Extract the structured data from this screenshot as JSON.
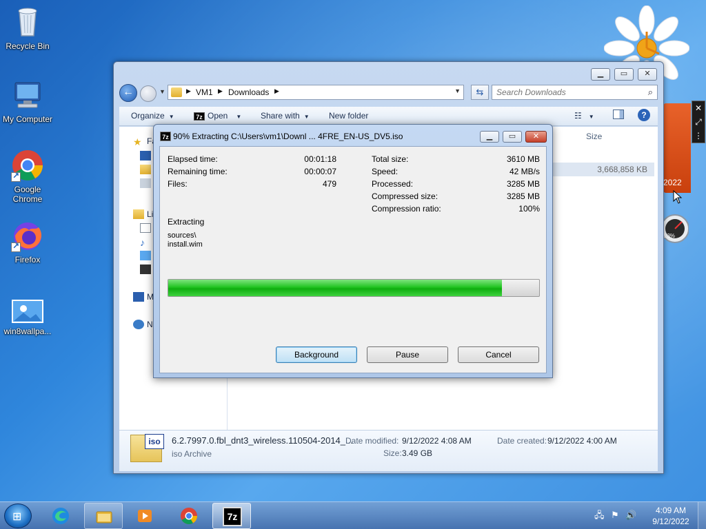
{
  "desktop": {
    "icons": [
      {
        "label": "Recycle Bin",
        "icon": "recycle-bin-icon"
      },
      {
        "label": "My Computer",
        "icon": "computer-icon"
      },
      {
        "label": "Google Chrome",
        "icon": "chrome-icon"
      },
      {
        "label": "Firefox",
        "icon": "firefox-icon"
      },
      {
        "label": "win8wallpa...",
        "icon": "image-file-icon"
      }
    ]
  },
  "gadgets": {
    "calendar_year": "2022",
    "meter_label": "23%"
  },
  "explorer": {
    "breadcrumb": [
      "VM1",
      "Downloads"
    ],
    "search_placeholder": "Search Downloads",
    "toolbar": {
      "organize": "Organize",
      "open": "Open",
      "share_with": "Share with",
      "new_folder": "New folder"
    },
    "nav_partials": {
      "favorites": "Fa",
      "libraries": "Li",
      "computer": "M",
      "network": "N"
    },
    "columns": {
      "size": "Size"
    },
    "selected_file_size": "3,668,858 KB",
    "details": {
      "file_name": "6.2.7997.0.fbl_dnt3_wireless.110504-2014_...",
      "file_type": "iso Archive",
      "date_modified_label": "Date modified:",
      "date_modified": "9/12/2022 4:08 AM",
      "date_created_label": "Date created:",
      "date_created": "9/12/2022 4:00 AM",
      "size_label": "Size:",
      "size": "3.49 GB",
      "icon_tag": "iso"
    }
  },
  "dialog": {
    "title": "90% Extracting C:\\Users\\vm1\\Downl ... 4FRE_EN-US_DV5.iso",
    "app_icon": "7z",
    "left_stats": [
      {
        "label": "Elapsed time:",
        "value": "00:01:18"
      },
      {
        "label": "Remaining time:",
        "value": "00:00:07"
      },
      {
        "label": "Files:",
        "value": "479"
      }
    ],
    "right_stats": [
      {
        "label": "Total size:",
        "value": "3610 MB"
      },
      {
        "label": "Speed:",
        "value": "42 MB/s"
      },
      {
        "label": "Processed:",
        "value": "3285 MB"
      },
      {
        "label": "Compressed size:",
        "value": "3285 MB"
      },
      {
        "label": "Compression ratio:",
        "value": "100%"
      }
    ],
    "status_label": "Extracting",
    "current_path": "sources\\",
    "current_file": "install.wim",
    "progress": 0.9,
    "buttons": {
      "background": "Background",
      "pause": "Pause",
      "cancel": "Cancel"
    }
  },
  "taskbar": {
    "apps": [
      "edge-icon",
      "file-explorer-icon",
      "media-player-icon",
      "chrome-icon",
      "7zip-icon"
    ],
    "sevenzip_label": "7z",
    "clock_time": "4:09 AM",
    "clock_date": "9/12/2022"
  },
  "colors": {
    "progress_green": "#22c422",
    "desktop_blue": "#2f86dc",
    "calendar_orange": "#e8622a"
  }
}
